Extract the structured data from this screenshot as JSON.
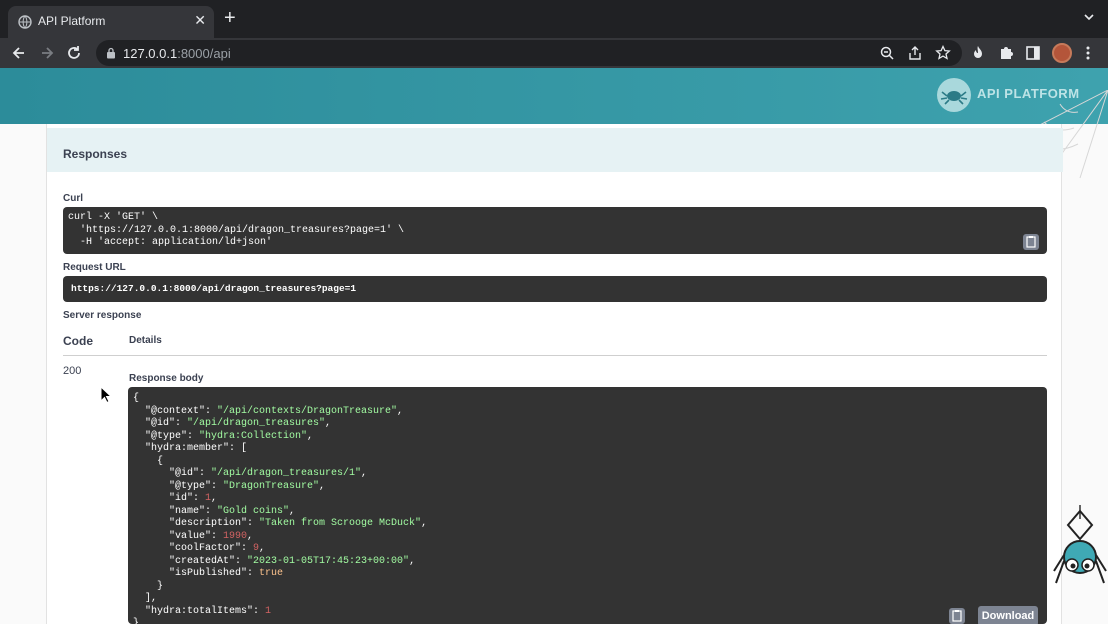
{
  "browser": {
    "tab_title": "API Platform",
    "tab_close": "✕",
    "new_tab": "+",
    "url_host": "127.0.0.1",
    "url_rest": ":8000/api"
  },
  "header": {
    "logo_text": "API PLATFORM"
  },
  "responses": {
    "title": "Responses",
    "curl_label": "Curl",
    "curl_command": "curl -X 'GET' \\\n  'https://127.0.0.1:8000/api/dragon_treasures?page=1' \\\n  -H 'accept: application/ld+json'",
    "request_url_label": "Request URL",
    "request_url": "https://127.0.0.1:8000/api/dragon_treasures?page=1",
    "server_response_label": "Server response",
    "code_header": "Code",
    "details_header": "Details",
    "status_code": "200",
    "response_body_label": "Response body",
    "download_label": "Download"
  },
  "response_body": {
    "context": "\"/api/contexts/DragonTreasure\"",
    "id": "\"/api/dragon_treasures\"",
    "type": "\"hydra:Collection\"",
    "member_id": "\"/api/dragon_treasures/1\"",
    "member_type": "\"DragonTreasure\"",
    "member_num_id": "1",
    "member_name": "\"Gold coins\"",
    "member_description": "\"Taken from Scrooge McDuck\"",
    "member_value": "1990",
    "member_cool_factor": "9",
    "member_created_at": "\"2023-01-05T17:45:23+00:00\"",
    "member_is_published": "true",
    "total_items": "1"
  },
  "icons": {
    "favicon": "globe-icon",
    "copy": "clipboard-icon",
    "lock": "lock-icon"
  },
  "colors": {
    "header_accent": "#2c8c9a",
    "code_background": "#333333",
    "string_color": "#a2fca2",
    "number_color": "#d36363"
  }
}
